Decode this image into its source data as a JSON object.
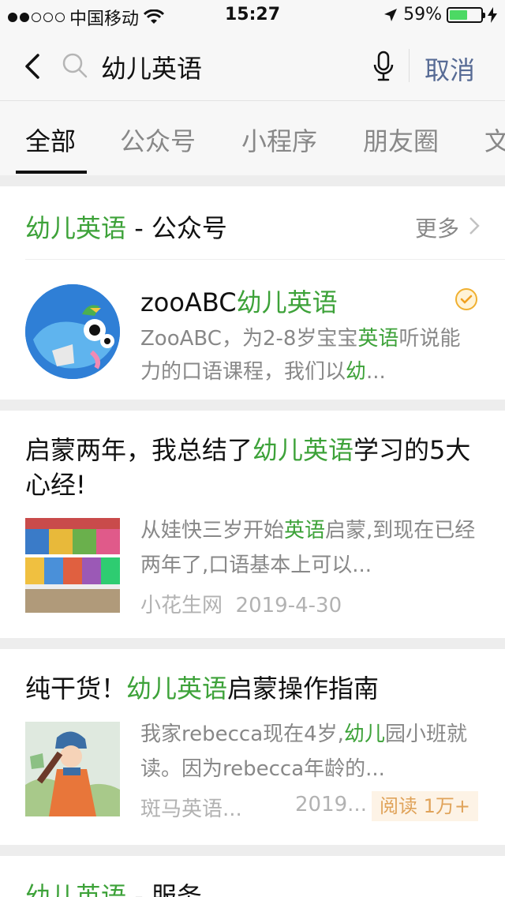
{
  "status_bar": {
    "carrier": "中国移动",
    "time": "15:27",
    "battery": "59%",
    "battery_level": 0.59
  },
  "search": {
    "query": "幼儿英语",
    "cancel_label": "取消"
  },
  "tabs": [
    "全部",
    "公众号",
    "小程序",
    "朋友圈",
    "文"
  ],
  "active_tab": 0,
  "accounts_section": {
    "title_keyword": "幼儿英语",
    "title_suffix": " - 公众号",
    "more_label": "更多",
    "account": {
      "name_prefix": "zooABC",
      "name_keyword": "幼儿英语",
      "desc_part1": "ZooABC，为2-8岁宝宝",
      "desc_kw1": "英语",
      "desc_part2": "听说能力的口语课程，我们以",
      "desc_kw2": "幼",
      "desc_ellipsis": "..."
    }
  },
  "articles": [
    {
      "title_prefix": "启蒙两年，我总结了",
      "title_keyword": "幼儿英语",
      "title_suffix": "学习的5大心经!",
      "desc_prefix": "从娃快三岁开始",
      "desc_keyword": "英语",
      "desc_suffix": "启蒙,到现在已经两年了,口语基本上可以...",
      "source": "小花生网",
      "date": "2019-4-30"
    },
    {
      "title_prefix": "纯干货！",
      "title_keyword": "幼儿英语",
      "title_suffix": "启蒙操作指南",
      "desc_prefix": "我家rebecca现在4岁,",
      "desc_keyword": "幼儿",
      "desc_suffix": "园小班就读。因为rebecca年龄的...",
      "source": "斑马英语...",
      "date": "2019...",
      "read_badge": "阅读 1万+"
    }
  ],
  "services_section": {
    "title_keyword": "幼儿英语",
    "title_suffix": " - 服务"
  },
  "colors": {
    "highlight": "#3da239",
    "link": "#576b95",
    "background": "#ededed"
  }
}
